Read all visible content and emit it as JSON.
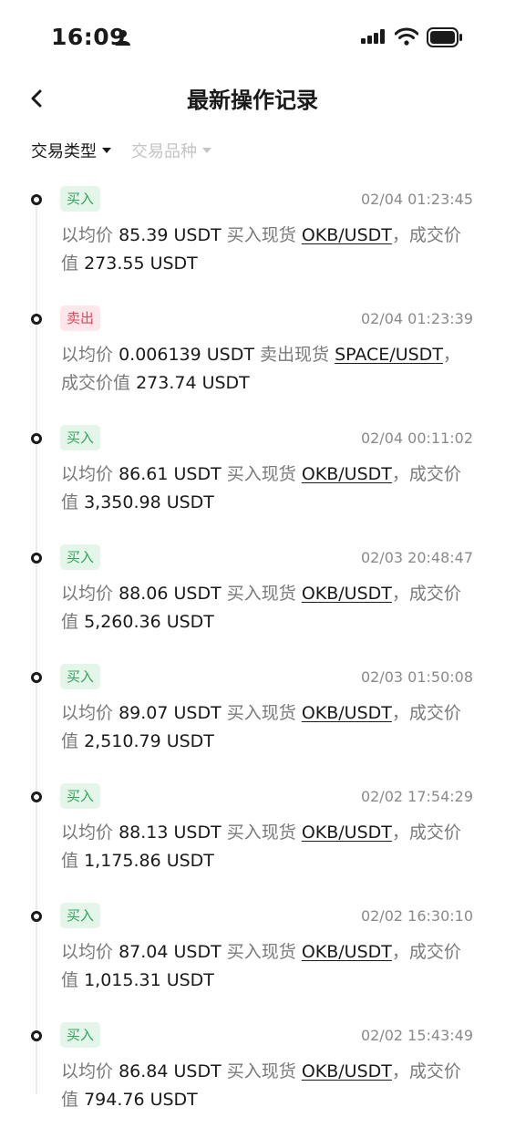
{
  "status_bar": {
    "time": "16:09"
  },
  "header": {
    "title": "最新操作记录"
  },
  "filters": [
    {
      "label": "交易类型",
      "active": true
    },
    {
      "label": "交易品种",
      "active": false
    }
  ],
  "colors": {
    "buy": "#2fa65a",
    "sell": "#e2455c",
    "muted": "#7a7a7a"
  },
  "entries": [
    {
      "type": "买入",
      "kind": "buy",
      "time": "02/04 01:23:45",
      "prefix": "以均价",
      "price": "85.39 USDT",
      "action": "买入现货",
      "pair": "OKB/USDT",
      "sep": "，",
      "mid": "成交价值",
      "value": "273.55 USDT"
    },
    {
      "type": "卖出",
      "kind": "sell",
      "time": "02/04 01:23:39",
      "prefix": "以均价",
      "price": "0.006139 USDT",
      "action": "卖出现货",
      "pair": "SPACE/USDT",
      "sep": "，",
      "mid": "成交价值",
      "value": "273.74 USDT"
    },
    {
      "type": "买入",
      "kind": "buy",
      "time": "02/04 00:11:02",
      "prefix": "以均价",
      "price": "86.61 USDT",
      "action": "买入现货",
      "pair": "OKB/USDT",
      "sep": "，",
      "mid": "成交价值",
      "value": "3,350.98 USDT"
    },
    {
      "type": "买入",
      "kind": "buy",
      "time": "02/03 20:48:47",
      "prefix": "以均价",
      "price": "88.06 USDT",
      "action": "买入现货",
      "pair": "OKB/USDT",
      "sep": "，",
      "mid": "成交价值",
      "value": "5,260.36 USDT"
    },
    {
      "type": "买入",
      "kind": "buy",
      "time": "02/03 01:50:08",
      "prefix": "以均价",
      "price": "89.07 USDT",
      "action": "买入现货",
      "pair": "OKB/USDT",
      "sep": "，",
      "mid": "成交价值",
      "value": "2,510.79 USDT"
    },
    {
      "type": "买入",
      "kind": "buy",
      "time": "02/02 17:54:29",
      "prefix": "以均价",
      "price": "88.13 USDT",
      "action": "买入现货",
      "pair": "OKB/USDT",
      "sep": "，",
      "mid": "成交价值",
      "value": "1,175.86 USDT"
    },
    {
      "type": "买入",
      "kind": "buy",
      "time": "02/02 16:30:10",
      "prefix": "以均价",
      "price": "87.04 USDT",
      "action": "买入现货",
      "pair": "OKB/USDT",
      "sep": "，",
      "mid": "成交价值",
      "value": "1,015.31 USDT"
    },
    {
      "type": "买入",
      "kind": "buy",
      "time": "02/02 15:43:49",
      "prefix": "以均价",
      "price": "86.84 USDT",
      "action": "买入现货",
      "pair": "OKB/USDT",
      "sep": "，",
      "mid": "成交价值",
      "value": "794.76 USDT"
    }
  ]
}
